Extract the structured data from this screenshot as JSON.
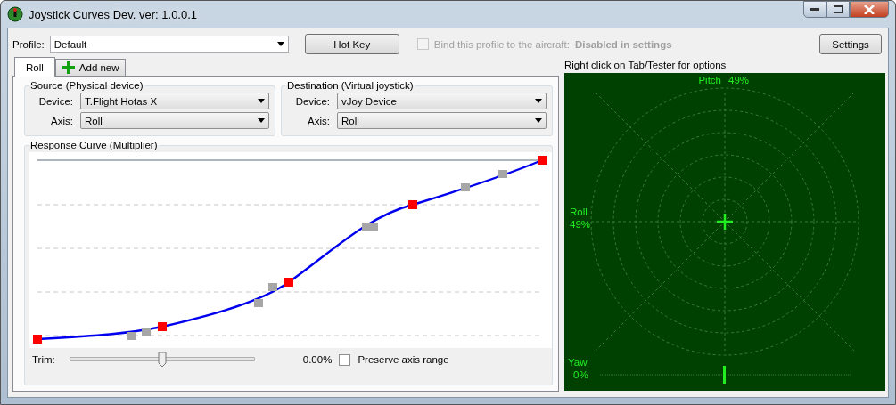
{
  "window": {
    "title": "Joystick Curves Dev. ver: 1.0.0.1"
  },
  "profile": {
    "label": "Profile:",
    "value": "Default"
  },
  "hotkey_button": "Hot Key",
  "bind_checkbox": {
    "label": "Bind this profile to the aircraft:",
    "checked": false,
    "disabled": true
  },
  "bind_status": "Disabled in settings",
  "settings_button": "Settings",
  "hint": "Right click on Tab/Tester for options",
  "tabs": [
    {
      "label": "Roll",
      "selected": true,
      "kind": "axis"
    },
    {
      "label": "Add new",
      "selected": false,
      "kind": "add"
    }
  ],
  "source": {
    "title": "Source (Physical device)",
    "device_label": "Device:",
    "device": "T.Flight Hotas X",
    "axis_label": "Axis:",
    "axis": "Roll"
  },
  "destination": {
    "title": "Destination (Virtual joystick)",
    "device_label": "Device:",
    "device": "vJoy Device",
    "axis_label": "Axis:",
    "axis": "Roll"
  },
  "response_curve": {
    "title": "Response Curve (Multiplier)"
  },
  "trim": {
    "label": "Trim:",
    "level": 0.5,
    "reading": "0.00%"
  },
  "preserve": {
    "label": "Preserve axis range",
    "checked": false
  },
  "tester": {
    "pitch": {
      "label": "Pitch",
      "reading": "49%"
    },
    "roll": {
      "label": "Roll",
      "reading": "49%"
    },
    "yaw": {
      "label": "Yaw",
      "reading": "0%"
    }
  }
}
